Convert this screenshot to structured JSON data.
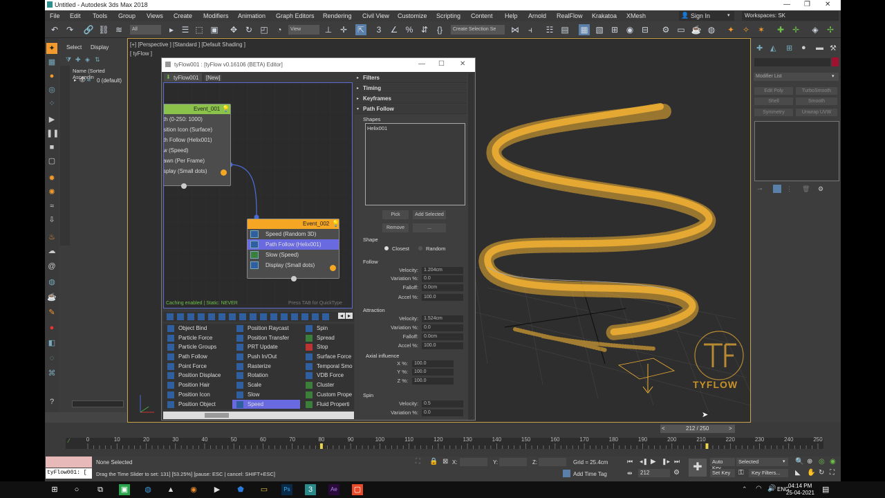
{
  "window": {
    "title": "Untitled - Autodesk 3ds Max 2018"
  },
  "menu": [
    "File",
    "Edit",
    "Tools",
    "Group",
    "Views",
    "Create",
    "Modifiers",
    "Animation",
    "Graph Editors",
    "Rendering",
    "Civil View",
    "Customize",
    "Scripting",
    "Content",
    "Help",
    "Arnold",
    "RealFlow",
    "Krakatoa",
    "XMesh"
  ],
  "signin": "Sign In",
  "workspaces": "Workspaces: SK",
  "toolbar": {
    "filter": "All",
    "view": "View",
    "selection_set": "Create Selection Se"
  },
  "scene_explorer": {
    "tab_select": "Select",
    "tab_display": "Display",
    "column": "Name (Sorted Ascendin",
    "item": "0 (default)"
  },
  "viewport": {
    "label1": "[+] [Perspective ] [Standard ] [Default Shading ]",
    "label2": "[ tyFlow ]"
  },
  "tyflow_logo": "TYFLOW",
  "tyflow": {
    "title": "tyFlow001 : [tyFlow v0.16106 (BETA) Editor]",
    "tab_name": "tyFlow001",
    "tab_new": "[New]",
    "event1": {
      "name": "Event_001",
      "ops": [
        "th (0-250: 1000)",
        "sition Icon (Surface)",
        "th Follow (Helix001)",
        "w (Speed)",
        "awn (Per Frame)",
        "splay (Small dots)"
      ]
    },
    "event2": {
      "name": "Event_002",
      "ops": [
        "Speed (Random 3D)",
        "Path Follow (Helix001)",
        "Slow (Speed)",
        "Display (Small dots)"
      ]
    },
    "status_left": "Caching enabled | Static: NEVER",
    "status_right": "Press TAB for QuickType",
    "operators": [
      [
        "Object Bind",
        "Particle Force",
        "Particle Groups",
        "Path Follow",
        "Point Force",
        "Position Displace",
        "Position Hair",
        "Position Icon",
        "Position Object"
      ],
      [
        "Position Raycast",
        "Position Transfer",
        "PRT Update",
        "Push In/Out",
        "Rasterize",
        "Rotation",
        "Scale",
        "Slow",
        "Speed"
      ],
      [
        "Spin",
        "Spread",
        "Stop",
        "Surface Force",
        "Temporal Smo",
        "VDB Force",
        "Cluster",
        "Custom Prope",
        "Fluid Properti"
      ]
    ]
  },
  "params": {
    "sections": [
      "Filters",
      "Timing",
      "Keyframes",
      "Path Follow"
    ],
    "shapes_label": "Shapes",
    "shapes_item": "Helix001",
    "btn_pick": "Pick",
    "btn_add_selected": "Add Selected",
    "btn_remove": "Remove",
    "btn_more": "...",
    "shape_label": "Shape",
    "shape_closest": "Closest",
    "shape_random": "Random",
    "follow_label": "Follow",
    "follow": [
      [
        "Velocity:",
        "1.204cm"
      ],
      [
        "Variation %:",
        "0.0"
      ],
      [
        "Falloff:",
        "0.0cm"
      ],
      [
        "Accel %:",
        "100.0"
      ]
    ],
    "attraction_label": "Attraction",
    "attraction": [
      [
        "Velocity:",
        "1.524cm"
      ],
      [
        "Variation %:",
        "0.0"
      ],
      [
        "Falloff:",
        "0.0cm"
      ],
      [
        "Accel %:",
        "100.0"
      ]
    ],
    "axial_label": "Axial influence",
    "axial": [
      [
        "X %:",
        "100.0"
      ],
      [
        "Y %:",
        "100.0"
      ],
      [
        "Z %:",
        "100.0"
      ]
    ],
    "spin_label": "Spin",
    "spin": [
      [
        "Velocity:",
        "0.5"
      ],
      [
        "Variation %:",
        "0.0"
      ]
    ]
  },
  "modifier_panel": {
    "list": "Modifier List",
    "buttons": [
      "Edit Poly",
      "TurboSmooth",
      "Shell",
      "Smooth",
      "Symmetry",
      "Unwrap UVW"
    ]
  },
  "timeline": {
    "frame": "212 / 250",
    "ticks": [
      "0",
      "10",
      "20",
      "30",
      "40",
      "50",
      "60",
      "70",
      "80",
      "90",
      "100",
      "110",
      "120",
      "130",
      "140",
      "150",
      "160",
      "170",
      "180",
      "190",
      "200",
      "210",
      "220",
      "230",
      "240",
      "250"
    ],
    "current_fraction": 0.848
  },
  "status": {
    "script_listener": "tyFlow001: [",
    "selection": "None Selected",
    "prompt": "Drag the Time Slider to set: 131] [53.25%] [pause: ESC | cancel: SHIFT+ESC]",
    "x": "X:",
    "y": "Y:",
    "z": "Z:",
    "grid": "Grid = 25.4cm",
    "add_time_tag": "Add Time Tag",
    "frame_field": "212",
    "auto_key": "Auto Key",
    "set_key": "Set Key",
    "selected": "Selected",
    "key_filters": "Key Filters..."
  },
  "taskbar": {
    "lang": "ENG",
    "time": "04:14 PM",
    "date": "25-04-2021"
  },
  "colors": {
    "event_green": "#8bc34a",
    "event_orange": "#f5a623",
    "particle": "#f2b233",
    "viewport_border": "#c9a24a",
    "selection_blue": "#6a6ae0"
  }
}
